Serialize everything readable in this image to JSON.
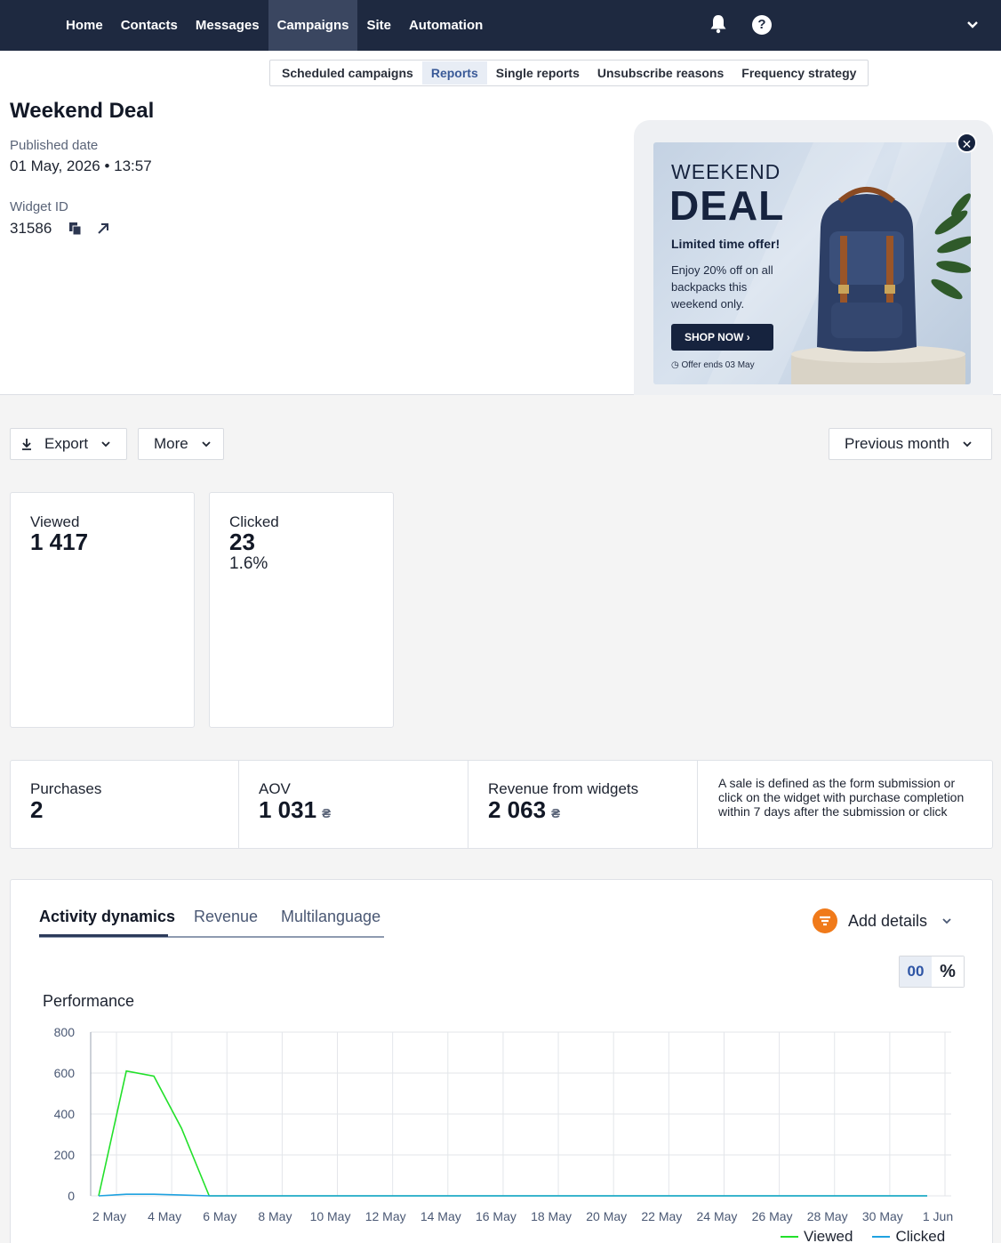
{
  "nav": {
    "items": [
      {
        "label": "Home"
      },
      {
        "label": "Contacts"
      },
      {
        "label": "Messages"
      },
      {
        "label": "Campaigns",
        "active": true
      },
      {
        "label": "Site"
      },
      {
        "label": "Automation"
      }
    ],
    "help_glyph": "?"
  },
  "subnav": {
    "items": [
      {
        "label": "Scheduled campaigns"
      },
      {
        "label": "Reports",
        "active": true
      },
      {
        "label": "Single reports"
      },
      {
        "label": "Unsubscribe reasons"
      },
      {
        "label": "Frequency strategy"
      }
    ]
  },
  "header": {
    "title": "Weekend Deal",
    "published_label": "Published date",
    "published_value": "01 May, 2026 • 13:57",
    "widget_label": "Widget ID",
    "widget_value": "31586"
  },
  "banner": {
    "line1": "WEEKEND",
    "line2": "DEAL",
    "headline": "Limited time offer!",
    "body": "Enjoy 20% off on all backpacks this weekend only.",
    "cta": "SHOP NOW",
    "footer": "Offer ends 03 May"
  },
  "toolbar": {
    "export_label": "Export",
    "more_label": "More",
    "period_label": "Previous month"
  },
  "cards": {
    "viewed": {
      "label": "Viewed",
      "value": "1 417"
    },
    "clicked": {
      "label": "Clicked",
      "value": "23",
      "pct": "1.6%"
    }
  },
  "stats": {
    "purchases": {
      "label": "Purchases",
      "value": "2"
    },
    "aov": {
      "label": "AOV",
      "value": "1 031",
      "currency": "₴"
    },
    "revenue": {
      "label": "Revenue from widgets",
      "value": "2 063",
      "currency": "₴"
    },
    "note": "A sale is defined as the form submission or click on the widget with purchase completion within 7 days after the submission or click"
  },
  "chart_panel": {
    "tabs": [
      {
        "label": "Activity dynamics",
        "active": true
      },
      {
        "label": "Revenue"
      },
      {
        "label": "Multilanguage"
      }
    ],
    "add_details_label": "Add details",
    "toggle_abs": "00",
    "toggle_pct": "%",
    "title": "Performance"
  },
  "colors": {
    "nav_bg": "#1e2940",
    "accent_orange": "#f07a1a",
    "viewed_line": "#22e02a",
    "clicked_line": "#1fa2e0"
  },
  "chart_data": {
    "type": "line",
    "title": "Performance",
    "x": [
      "1 May",
      "2 May",
      "3 May",
      "4 May",
      "5 May",
      "6 May",
      "7 May",
      "8 May",
      "9 May",
      "10 May",
      "11 May",
      "12 May",
      "13 May",
      "14 May",
      "15 May",
      "16 May",
      "17 May",
      "18 May",
      "19 May",
      "20 May",
      "21 May",
      "22 May",
      "23 May",
      "24 May",
      "25 May",
      "26 May",
      "27 May",
      "28 May",
      "29 May",
      "30 May",
      "31 May",
      "1 Jun"
    ],
    "x_tick_labels": [
      "2 May",
      "4 May",
      "6 May",
      "8 May",
      "10 May",
      "12 May",
      "14 May",
      "16 May",
      "18 May",
      "20 May",
      "22 May",
      "24 May",
      "26 May",
      "28 May",
      "30 May",
      "1 Jun"
    ],
    "series": [
      {
        "name": "Viewed",
        "values": [
          0,
          0,
          610,
          585,
          330,
          0,
          0,
          0,
          0,
          0,
          0,
          0,
          0,
          0,
          0,
          0,
          0,
          0,
          0,
          0,
          0,
          0,
          0,
          0,
          0,
          0,
          0,
          0,
          0,
          0,
          0,
          0
        ]
      },
      {
        "name": "Clicked",
        "values": [
          0,
          0,
          8,
          8,
          4,
          0,
          0,
          0,
          0,
          0,
          0,
          0,
          0,
          0,
          0,
          0,
          0,
          0,
          0,
          0,
          0,
          0,
          0,
          0,
          0,
          0,
          0,
          0,
          0,
          0,
          0,
          0
        ]
      }
    ],
    "ylim": [
      0,
      800
    ],
    "y_ticks": [
      0,
      200,
      400,
      600,
      800
    ],
    "grid": true,
    "legend": "bottom-right"
  }
}
